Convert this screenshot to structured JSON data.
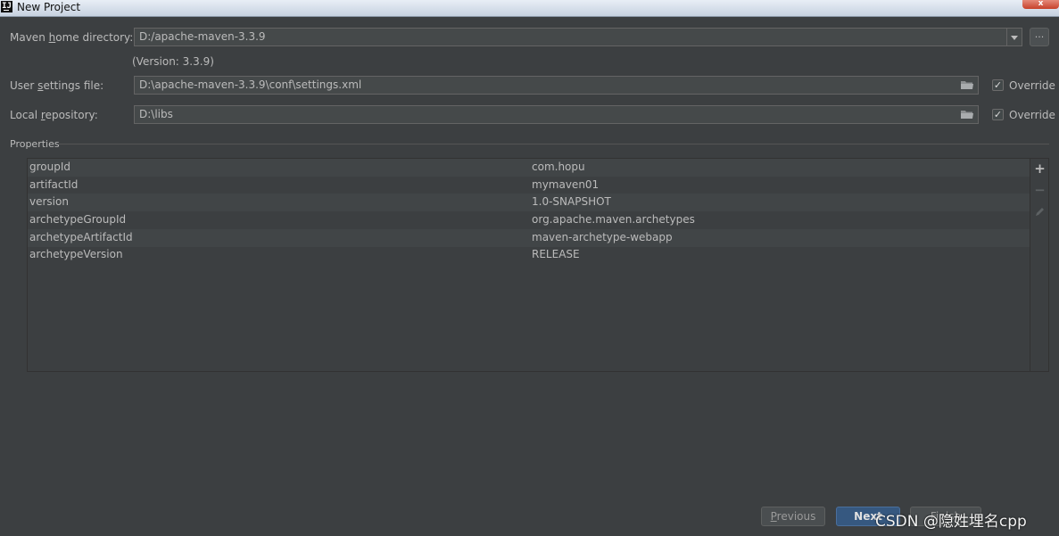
{
  "window": {
    "title": "New Project",
    "close_glyph": "x",
    "app_icon_letter": "IJ"
  },
  "maven_home": {
    "label_pre": "Maven ",
    "label_u": "h",
    "label_post": "ome directory:",
    "value": "D:/apache-maven-3.3.9",
    "version_note": "(Version: 3.3.9)",
    "browse_label": "..."
  },
  "user_settings": {
    "label_pre": "User ",
    "label_u": "s",
    "label_post": "ettings file:",
    "value": "D:\\apache-maven-3.3.9\\conf\\settings.xml",
    "override_label": "Override",
    "override_checked": true
  },
  "local_repo": {
    "label_pre": "Local ",
    "label_u": "r",
    "label_post": "epository:",
    "value": "D:\\libs",
    "override_label": "Override",
    "override_checked": true
  },
  "properties": {
    "section_label": "Properties",
    "rows": [
      {
        "key": "groupId",
        "value": "com.hopu"
      },
      {
        "key": "artifactId",
        "value": "mymaven01"
      },
      {
        "key": "version",
        "value": "1.0-SNAPSHOT"
      },
      {
        "key": "archetypeGroupId",
        "value": "org.apache.maven.archetypes"
      },
      {
        "key": "archetypeArtifactId",
        "value": "maven-archetype-webapp"
      },
      {
        "key": "archetypeVersion",
        "value": "RELEASE"
      }
    ],
    "toolbar": {
      "add_glyph": "+",
      "remove_glyph": "−"
    }
  },
  "footer": {
    "previous_u": "P",
    "previous_rest": "revious",
    "next_label": "Next",
    "finish_label": "Finish"
  },
  "watermark": "CSDN @隐姓埋名cpp",
  "colors": {
    "background": "#3c3f41",
    "field": "#45494a",
    "accent": "#365880",
    "text": "#bbbbbb"
  }
}
